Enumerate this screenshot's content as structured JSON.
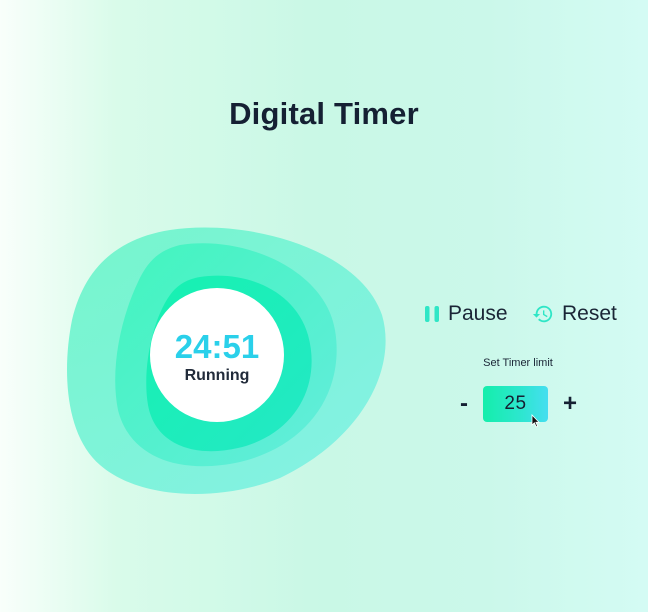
{
  "app": {
    "title": "Digital Timer"
  },
  "timer": {
    "time": "24:51",
    "status": "Running"
  },
  "controls": {
    "pause_label": "Pause",
    "reset_label": "Reset",
    "pause_icon": "pause-icon",
    "reset_icon": "history-icon"
  },
  "limit": {
    "label": "Set Timer limit",
    "decrement_label": "-",
    "value": "25",
    "increment_label": "+"
  },
  "colors": {
    "accent": "#2ad0ea",
    "blob_green": "#14eeab",
    "text_dark": "#152033"
  }
}
